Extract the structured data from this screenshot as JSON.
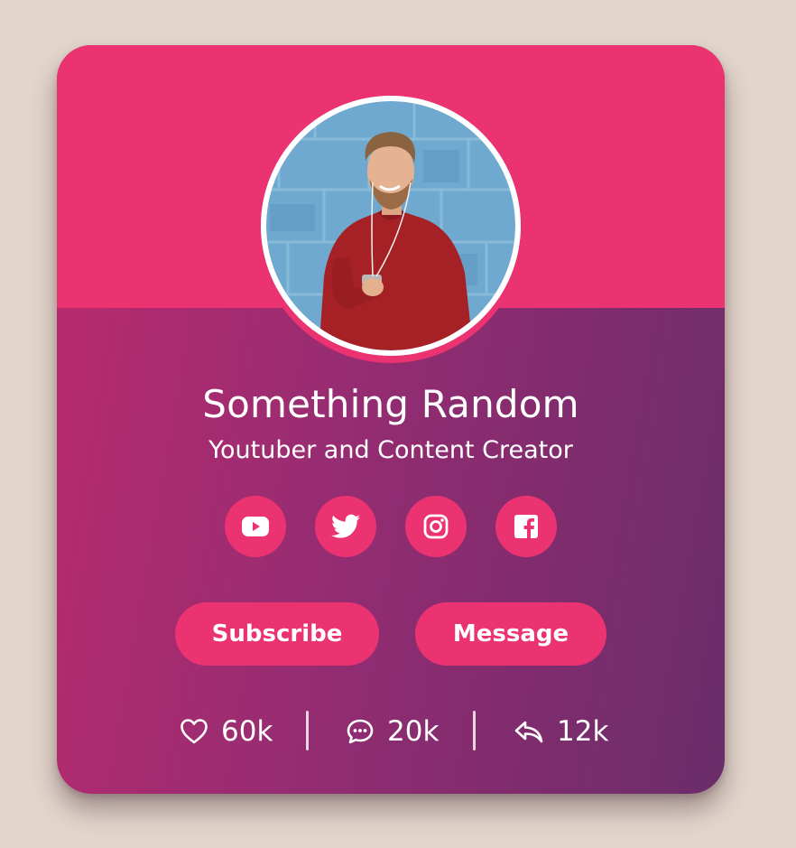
{
  "profile": {
    "name": "Something Random",
    "role": "Youtuber and Content Creator"
  },
  "social": [
    {
      "icon": "youtube-icon"
    },
    {
      "icon": "twitter-icon"
    },
    {
      "icon": "instagram-icon"
    },
    {
      "icon": "facebook-icon"
    }
  ],
  "actions": {
    "subscribe_label": "Subscribe",
    "message_label": "Message"
  },
  "stats": {
    "likes": "60k",
    "comments": "20k",
    "shares": "12k"
  },
  "colors": {
    "accent": "#ea3370",
    "gradient_start": "#bc2a6e",
    "gradient_end": "#6a2d69",
    "background": "#e2d6cc"
  }
}
